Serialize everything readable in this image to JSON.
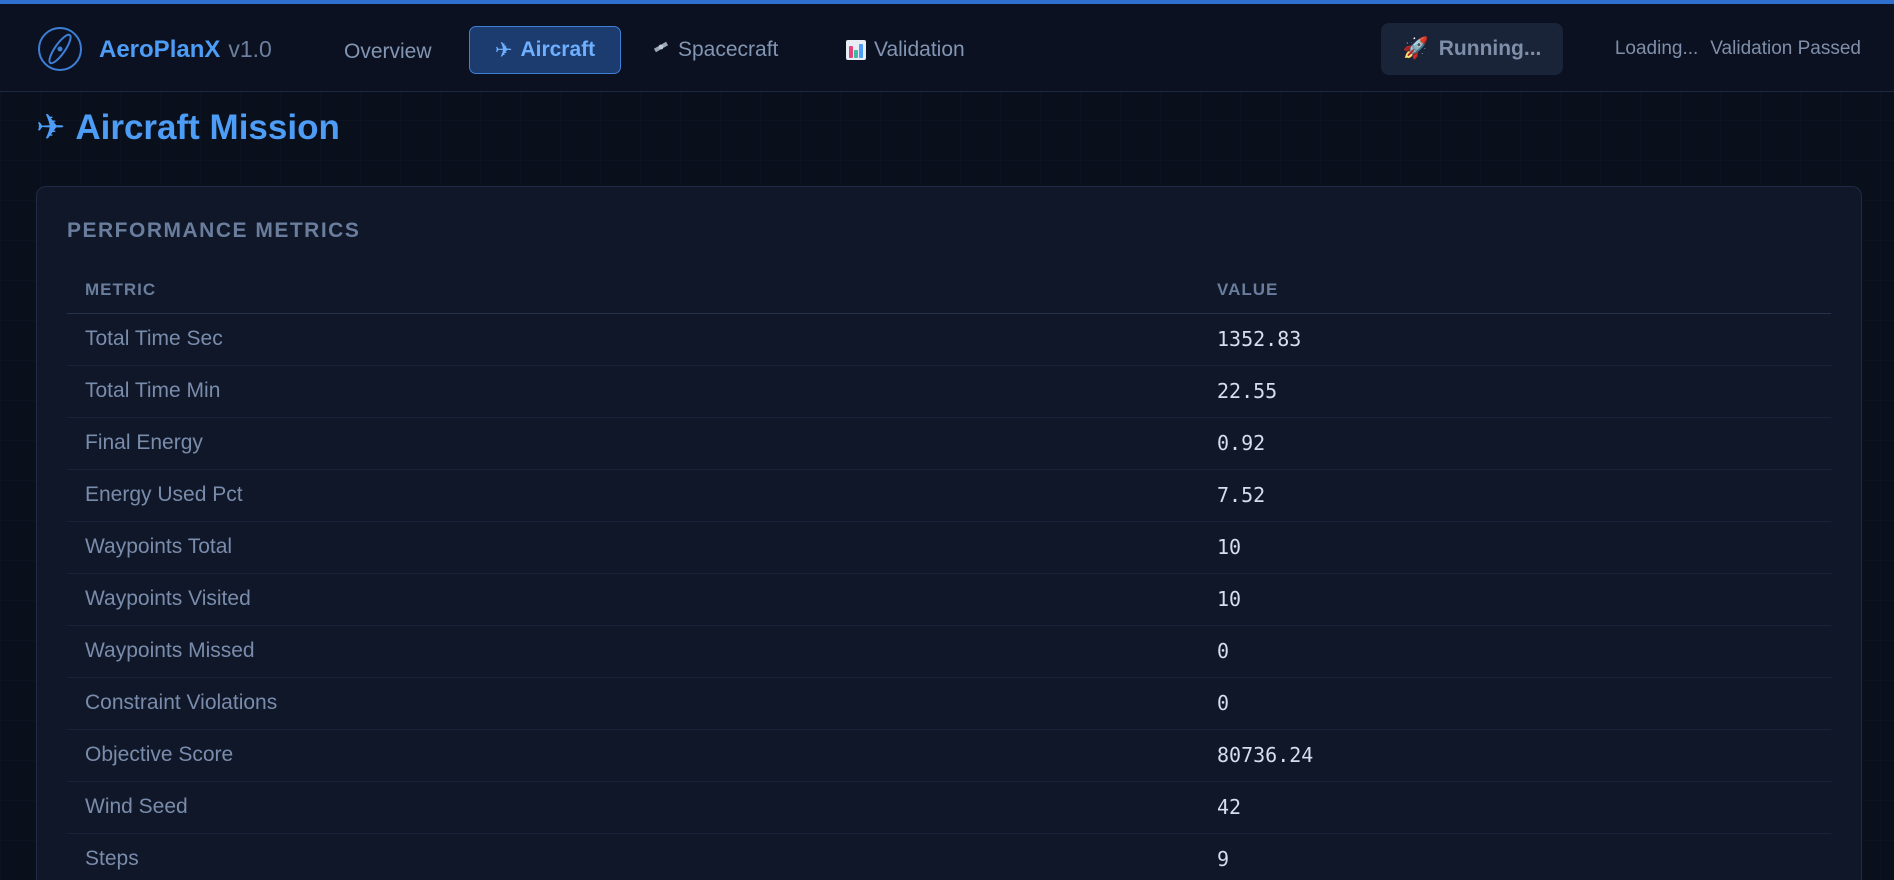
{
  "brand": {
    "name": "AeroPlanX",
    "version": "v1.0"
  },
  "nav": {
    "overview": "Overview",
    "aircraft": "Aircraft",
    "spacecraft": "Spacecraft",
    "validation": "Validation"
  },
  "run_button": {
    "label": "Running..."
  },
  "status": {
    "loading": "Loading...",
    "validation": "Validation Passed"
  },
  "page_title": "Aircraft Mission",
  "card": {
    "title": "PERFORMANCE METRICS",
    "columns": [
      "METRIC",
      "VALUE"
    ],
    "rows": [
      {
        "metric": "Total Time Sec",
        "value": "1352.83"
      },
      {
        "metric": "Total Time Min",
        "value": "22.55"
      },
      {
        "metric": "Final Energy",
        "value": "0.92"
      },
      {
        "metric": "Energy Used Pct",
        "value": "7.52"
      },
      {
        "metric": "Waypoints Total",
        "value": "10"
      },
      {
        "metric": "Waypoints Visited",
        "value": "10"
      },
      {
        "metric": "Waypoints Missed",
        "value": "0"
      },
      {
        "metric": "Constraint Violations",
        "value": "0"
      },
      {
        "metric": "Objective Score",
        "value": "80736.24"
      },
      {
        "metric": "Wind Seed",
        "value": "42"
      },
      {
        "metric": "Steps",
        "value": "9"
      }
    ]
  },
  "colors": {
    "accent": "#4d9cf5",
    "background": "#0a0f1c",
    "active_tab": "#1c3b6e"
  },
  "icons": {
    "logo": "orbit-logo-icon",
    "aircraft": "airplane-icon",
    "spacecraft": "satellite-icon",
    "validation": "bar-chart-icon",
    "run": "rocket-icon"
  }
}
